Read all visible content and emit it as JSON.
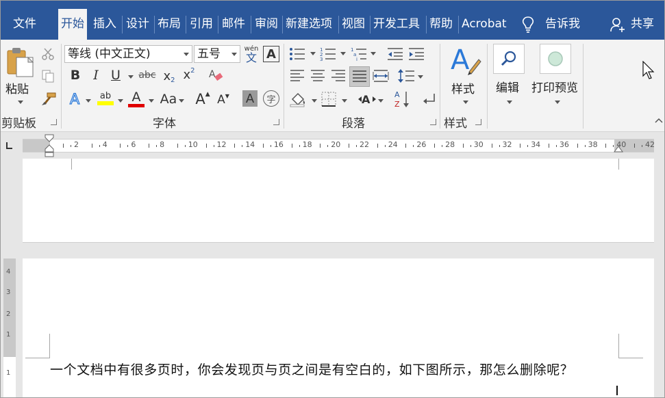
{
  "tabs": [
    {
      "label": "文件",
      "active": false
    },
    {
      "label": "开始",
      "active": true
    },
    {
      "label": "插入",
      "active": false
    },
    {
      "label": "设计",
      "active": false
    },
    {
      "label": "布局",
      "active": false
    },
    {
      "label": "引用",
      "active": false
    },
    {
      "label": "邮件",
      "active": false
    },
    {
      "label": "审阅",
      "active": false
    },
    {
      "label": "新建选项",
      "active": false
    },
    {
      "label": "视图",
      "active": false
    },
    {
      "label": "开发工具",
      "active": false
    },
    {
      "label": "帮助",
      "active": false
    },
    {
      "label": "Acrobat",
      "active": false
    }
  ],
  "tell_me": "告诉我",
  "share": "共享",
  "clipboard": {
    "paste_label": "粘贴",
    "group_label": "剪贴板"
  },
  "font": {
    "font_name": "等线 (中文正文)",
    "font_size": "五号",
    "phonetic_top": "wén",
    "phonetic_bottom": "文",
    "border_char": "A",
    "bold": "B",
    "italic": "I",
    "underline": "U",
    "strike": "abc",
    "sub": "x",
    "sup": "x",
    "text_effects": "A",
    "highlight": "ab",
    "font_color": "A",
    "change_case": "Aa",
    "grow": "A",
    "shrink": "A",
    "shade": "A",
    "enclose": "字",
    "group_label": "字体",
    "highlight_color": "#ffff00",
    "font_color_value": "#e00000"
  },
  "paragraph": {
    "group_label": "段落"
  },
  "styles": {
    "label": "样式",
    "group_label": "样式"
  },
  "editing": {
    "label": "编辑"
  },
  "print_preview": {
    "label": "打印预览"
  },
  "ruler": {
    "numbers": [
      "2",
      "4",
      "6",
      "8",
      "10",
      "12",
      "14",
      "16",
      "18",
      "20",
      "22",
      "24",
      "26",
      "28",
      "30",
      "32",
      "34",
      "36",
      "38",
      "40",
      "42"
    ]
  },
  "vruler": {
    "numbers": [
      "4",
      "3",
      "2",
      "1",
      "1"
    ]
  },
  "document": {
    "text": "一个文档中有很多页时，你会发现页与页之间是有空白的，如下图所示，那怎么删除呢？"
  },
  "colors": {
    "accent": "#2b579a"
  }
}
